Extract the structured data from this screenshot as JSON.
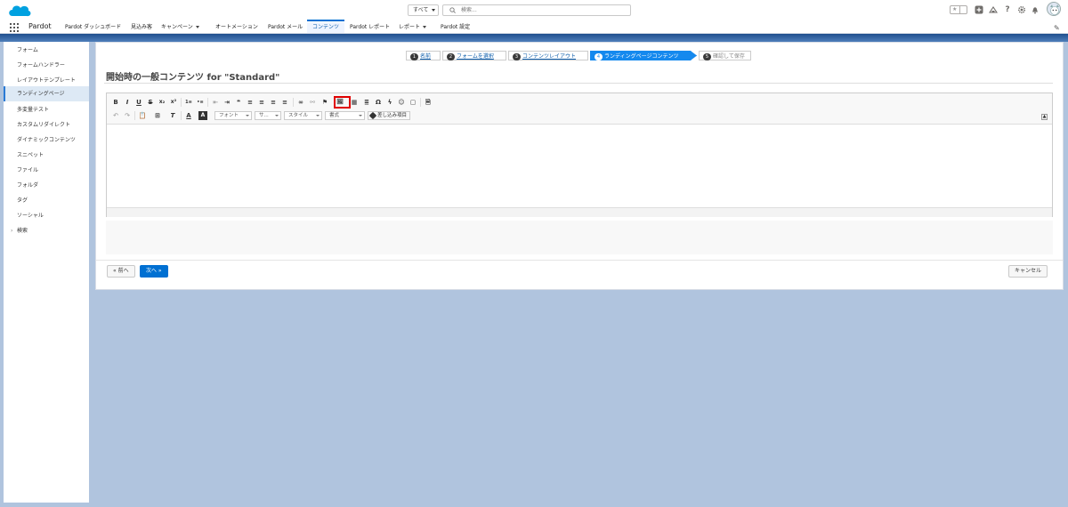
{
  "header": {
    "search_scope": "すべて",
    "search_placeholder": "検索...",
    "favorites_star": "★",
    "icons": [
      "favorites-star-icon",
      "add-icon",
      "trailhead-icon",
      "help-icon",
      "setup-gear-icon",
      "notifications-bell-icon",
      "user-avatar"
    ]
  },
  "nav": {
    "app_name": "Pardot",
    "items": [
      {
        "label": "Pardot ダッシュボード",
        "dropdown": false
      },
      {
        "label": "見込み客",
        "dropdown": false
      },
      {
        "label": "キャンペーン",
        "dropdown": true
      },
      {
        "label": "オートメーション",
        "dropdown": false
      },
      {
        "label": "Pardot メール",
        "dropdown": false
      },
      {
        "label": "コンテンツ",
        "dropdown": false,
        "active": true
      },
      {
        "label": "Pardot レポート",
        "dropdown": false
      },
      {
        "label": "レポート",
        "dropdown": true
      },
      {
        "label": "Pardot 設定",
        "dropdown": false
      }
    ]
  },
  "sidebar": {
    "items": [
      {
        "label": "フォーム"
      },
      {
        "label": "フォームハンドラー"
      },
      {
        "label": "レイアウトテンプレート"
      },
      {
        "label": "ランディングページ",
        "active": true
      },
      {
        "label": "多変量テスト"
      },
      {
        "label": "カスタムリダイレクト"
      },
      {
        "label": "ダイナミックコンテンツ"
      },
      {
        "label": "スニペット"
      },
      {
        "label": "ファイル"
      },
      {
        "label": "フォルダ"
      },
      {
        "label": "タグ"
      },
      {
        "label": "ソーシャル"
      },
      {
        "label": "検索",
        "expandable": true
      }
    ]
  },
  "wizard": {
    "steps": [
      {
        "num": "1",
        "label": "名前",
        "state": "done"
      },
      {
        "num": "2",
        "label": "フォームを選択",
        "state": "done"
      },
      {
        "num": "3",
        "label": "コンテンツレイアウト",
        "state": "done"
      },
      {
        "num": "4",
        "label": "ランディングページコンテンツ",
        "state": "current"
      },
      {
        "num": "5",
        "label": "確認して保存",
        "state": "disabled"
      }
    ]
  },
  "page": {
    "title": "開始時の一般コンテンツ for \"Standard\""
  },
  "editor": {
    "toolbar_row1": [
      "B",
      "I",
      "U",
      "S",
      "x₂",
      "x²",
      "1≡",
      "•≡",
      "⇤",
      "⇥",
      "❝",
      "≡",
      "≡",
      "≡",
      "≡",
      "∞",
      "⚯",
      "⚑",
      "🖼",
      "▦",
      "≣",
      "Ω",
      "ϟ",
      "☺",
      "▢",
      "🗎"
    ],
    "font_label": "フォント",
    "size_label": "サ...",
    "style_label": "スタイル",
    "format_label": "書式",
    "merge_field_label": "差し込み項目",
    "highlighted_button": "image-button"
  },
  "footer": {
    "prev_label": "« 前へ",
    "next_label": "次へ »",
    "cancel_label": "キャンセル"
  },
  "colors": {
    "accent": "#0070d2",
    "highlight": "#e00000",
    "background": "#b0c4de"
  }
}
